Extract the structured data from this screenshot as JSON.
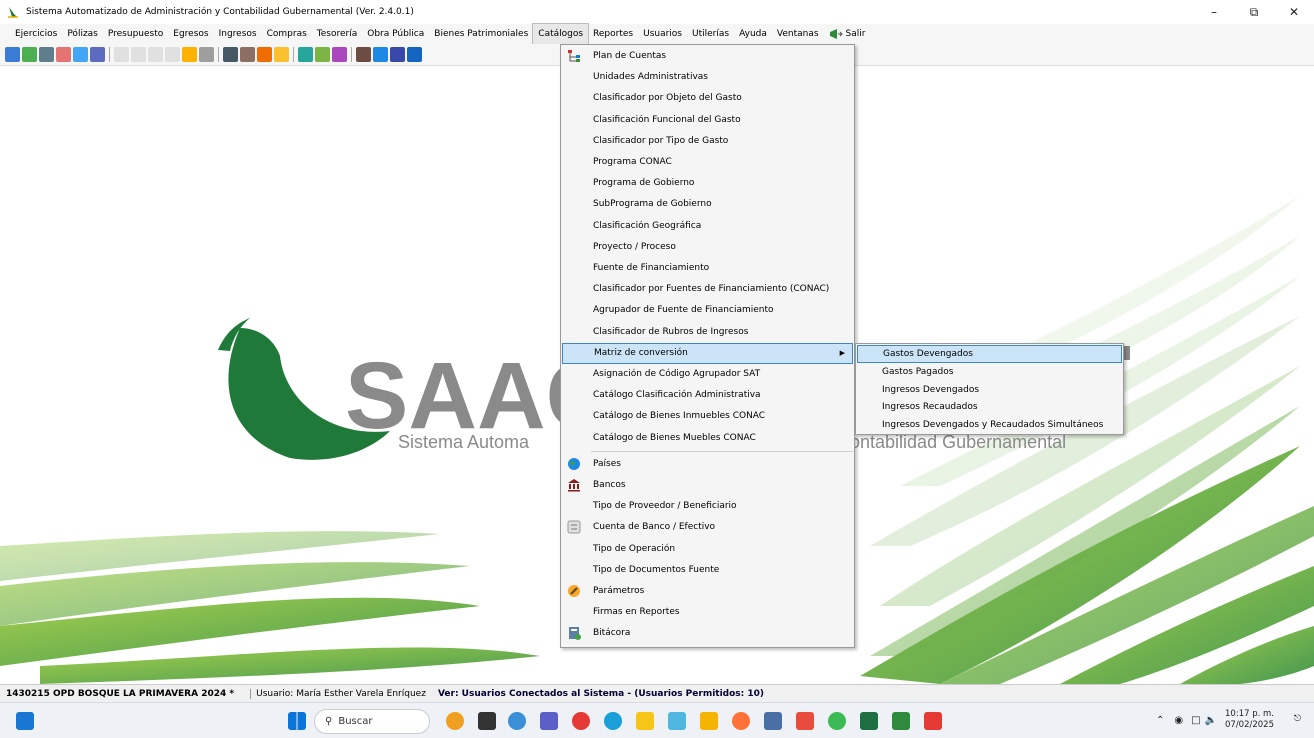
{
  "window": {
    "title": "Sistema Automatizado de Administración y Contabilidad Gubernamental (Ver. 2.4.0.1)"
  },
  "menubar": [
    {
      "label": "Ejercicios",
      "active": false
    },
    {
      "label": "Pólizas",
      "active": false
    },
    {
      "label": "Presupuesto",
      "active": false
    },
    {
      "label": "Egresos",
      "active": false
    },
    {
      "label": "Ingresos",
      "active": false
    },
    {
      "label": "Compras",
      "active": false
    },
    {
      "label": "Tesorería",
      "active": false
    },
    {
      "label": "Obra Pública",
      "active": false
    },
    {
      "label": "Bienes Patrimoniales",
      "active": false
    },
    {
      "label": "Catálogos",
      "active": true
    },
    {
      "label": "Reportes",
      "active": false
    },
    {
      "label": "Usuarios",
      "active": false
    },
    {
      "label": "Utilerías",
      "active": false
    },
    {
      "label": "Ayuda",
      "active": false
    },
    {
      "label": "Ventanas",
      "active": false
    },
    {
      "label": "Salir",
      "active": false
    }
  ],
  "logo": {
    "name": "SAACG",
    "tagline_left": "Sistema Automa",
    "tagline_right": "ontabilidad Gubernamental"
  },
  "catalogos_menu": [
    {
      "label": "Plan de Cuentas",
      "icon": "tree-icon"
    },
    {
      "label": "Unidades Administrativas"
    },
    {
      "label": "Clasificador por Objeto del Gasto"
    },
    {
      "label": "Clasificación Funcional del Gasto"
    },
    {
      "label": "Clasificador por Tipo de Gasto"
    },
    {
      "label": "Programa CONAC"
    },
    {
      "label": "Programa de Gobierno"
    },
    {
      "label": "SubPrograma de Gobierno"
    },
    {
      "label": "Clasificación Geográfica"
    },
    {
      "label": "Proyecto / Proceso"
    },
    {
      "label": "Fuente de Financiamiento"
    },
    {
      "label": "Clasificador por Fuentes de Financiamiento (CONAC)"
    },
    {
      "label": "Agrupador de Fuente de Financiamiento"
    },
    {
      "label": "Clasificador de Rubros de Ingresos"
    },
    {
      "label": "Matriz de conversión",
      "highlighted": true,
      "submenu": true
    },
    {
      "label": "Asignación de Código Agrupador SAT"
    },
    {
      "label": "Catálogo Clasificación Administrativa"
    },
    {
      "label": "Catálogo de Bienes Inmuebles CONAC"
    },
    {
      "label": "Catálogo de Bienes Muebles CONAC"
    },
    {
      "label": "Países",
      "icon": "globe-icon"
    },
    {
      "label": "Bancos",
      "icon": "bank-icon"
    },
    {
      "label": "Tipo de Proveedor / Beneficiario"
    },
    {
      "label": "Cuenta de Banco / Efectivo",
      "icon": "calculator-icon"
    },
    {
      "label": "Tipo de Operación"
    },
    {
      "label": "Tipo de Documentos Fuente"
    },
    {
      "label": "Parámetros",
      "icon": "wrench-icon"
    },
    {
      "label": "Firmas en Reportes"
    },
    {
      "label": "Bitácora",
      "icon": "log-icon"
    }
  ],
  "matriz_submenu": [
    {
      "label": "Gastos Devengados",
      "highlighted": true
    },
    {
      "label": "Gastos Pagados"
    },
    {
      "label": "Ingresos Devengados"
    },
    {
      "label": "Ingresos Recaudados"
    },
    {
      "label": "Ingresos Devengados y Recaudados Simultáneos"
    }
  ],
  "statusbar": {
    "entity": "1430215 OPD BOSQUE LA PRIMAVERA  2024  *",
    "user": "Usuario: María Esther Varela Enríquez",
    "connected": "Ver: Usuarios Conectados al Sistema - (Usuarios Permitidos: 10)"
  },
  "taskbar": {
    "search_placeholder": "Buscar",
    "time": "10:17 p. m.",
    "date": "07/02/2025"
  },
  "colors": {
    "logo_green": "#1f7a3a",
    "logo_gray": "#8a8a8a",
    "menu_highlight": "#cce4f7",
    "menu_highlight_border": "#3f86c8"
  }
}
